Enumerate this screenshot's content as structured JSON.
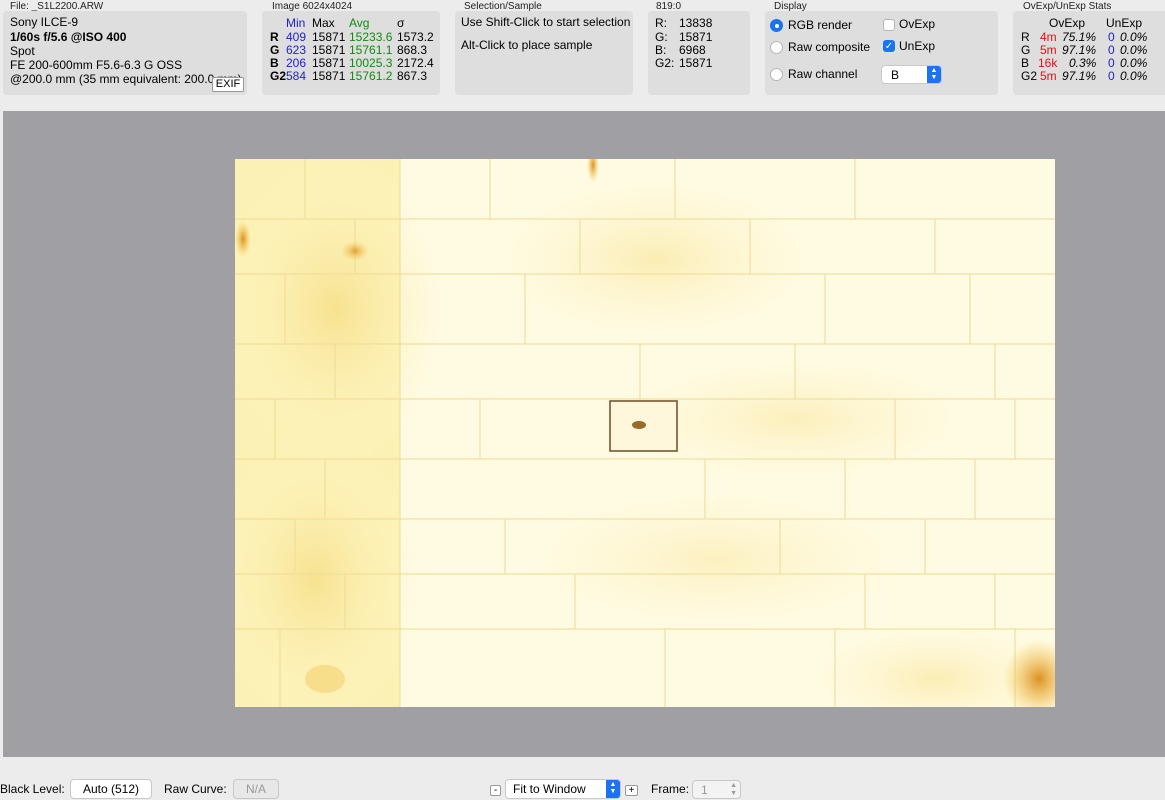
{
  "file": {
    "title": "File: _S1L2200.ARW",
    "camera": "Sony ILCE-9",
    "exposure": "1/60s f/5.6 @ISO 400",
    "metering": "Spot",
    "lens": "FE 200-600mm F5.6-6.3 G OSS",
    "focal": "@200.0 mm (35 mm equivalent: 200.0 mm)",
    "exif_button": "EXIF"
  },
  "image": {
    "title": "Image 6024x4024",
    "headers": {
      "min": "Min",
      "max": "Max",
      "avg": "Avg",
      "sigma": "σ"
    },
    "rows": [
      {
        "ch": "R",
        "min": "409",
        "max": "15871",
        "avg": "15233.6",
        "sigma": "1573.2"
      },
      {
        "ch": "G",
        "min": "623",
        "max": "15871",
        "avg": "15761.1",
        "sigma": "868.3"
      },
      {
        "ch": "B",
        "min": "206",
        "max": "15871",
        "avg": "10025.3",
        "sigma": "2172.4"
      },
      {
        "ch": "G2",
        "min": "584",
        "max": "15871",
        "avg": "15761.2",
        "sigma": "867.3"
      }
    ]
  },
  "selection": {
    "title": "Selection/Sample",
    "line1": "Use Shift-Click to start selection",
    "line2": "Alt-Click to place sample"
  },
  "sample": {
    "title": "819:0",
    "rows": [
      {
        "label": "R:",
        "value": "13838"
      },
      {
        "label": "G:",
        "value": "15871"
      },
      {
        "label": "B:",
        "value": "6968"
      },
      {
        "label": "G2:",
        "value": "15871"
      }
    ]
  },
  "display": {
    "title": "Display",
    "rgb_render": "RGB render",
    "raw_composite": "Raw composite",
    "raw_channel": "Raw channel",
    "selected_mode": "RGB render",
    "ovexp": "OvExp",
    "ovexp_checked": false,
    "unexp": "UnExp",
    "unexp_checked": true,
    "channel_value": "B"
  },
  "ovstats": {
    "title": "OvExp/UnExp Stats",
    "headers": {
      "ov": "OvExp",
      "un": "UnExp"
    },
    "rows": [
      {
        "ch": "R",
        "ov_count": "4m",
        "ov_pct": "75.1%",
        "un_count": "0",
        "un_pct": "0.0%"
      },
      {
        "ch": "G",
        "ov_count": "5m",
        "ov_pct": "97.1%",
        "un_count": "0",
        "un_pct": "0.0%"
      },
      {
        "ch": "B",
        "ov_count": "16k",
        "ov_pct": "0.3%",
        "un_count": "0",
        "un_pct": "0.0%"
      },
      {
        "ch": "G2",
        "ov_count": "5m",
        "ov_pct": "97.1%",
        "un_count": "0",
        "un_pct": "0.0%"
      }
    ]
  },
  "bottom": {
    "black_level_label": "Black Level:",
    "black_level_value": "Auto (512)",
    "raw_curve_label": "Raw Curve:",
    "raw_curve_value": "N/A",
    "zoom_minus": "-",
    "zoom_value": "Fit to Window",
    "zoom_plus": "+",
    "frame_label": "Frame:",
    "frame_value": "1"
  },
  "colors": {
    "accent": "#1a74f0",
    "min_color": "#1f1fd0",
    "avg_color": "#128a12",
    "overexposed_color": "#d11",
    "viewer_bg": "#a09fa3"
  }
}
